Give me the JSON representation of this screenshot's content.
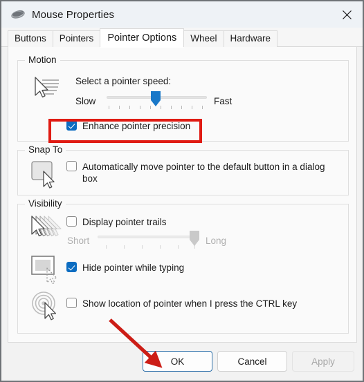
{
  "window": {
    "title": "Mouse Properties",
    "icon": "mouse-icon",
    "close_label": "✕"
  },
  "tabs": [
    {
      "label": "Buttons",
      "active": false
    },
    {
      "label": "Pointers",
      "active": false
    },
    {
      "label": "Pointer Options",
      "active": true
    },
    {
      "label": "Wheel",
      "active": false
    },
    {
      "label": "Hardware",
      "active": false
    }
  ],
  "motion": {
    "group_title": "Motion",
    "icon": "pointer-motion-icon",
    "speed_prompt": "Select a pointer speed:",
    "slow_label": "Slow",
    "fast_label": "Fast",
    "slider_value_percent": 50,
    "tick_count": 10,
    "enhance_precision": {
      "label": "Enhance pointer precision",
      "checked": true,
      "highlighted": true
    }
  },
  "snap_to": {
    "group_title": "Snap To",
    "icon": "snap-to-button-icon",
    "auto_move": {
      "label": "Automatically move pointer to the default button in a dialog box",
      "checked": false
    }
  },
  "visibility": {
    "group_title": "Visibility",
    "trails": {
      "icon": "pointer-trails-icon",
      "label": "Display pointer trails",
      "checked": false,
      "disabled_slider": true,
      "short_label": "Short",
      "long_label": "Long",
      "slider_value_percent": 96,
      "tick_count": 6
    },
    "hide_typing": {
      "icon": "hide-pointer-typing-icon",
      "label": "Hide pointer while typing",
      "checked": true
    },
    "show_location": {
      "icon": "show-pointer-location-icon",
      "label": "Show location of pointer when I press the CTRL key",
      "checked": false
    }
  },
  "footer": {
    "ok": "OK",
    "cancel": "Cancel",
    "apply": "Apply",
    "apply_disabled": true,
    "ok_focused": true
  },
  "annotations": {
    "highlight_color": "#e01b13",
    "arrow_color": "#cc1d16",
    "arrow_target": "OK"
  },
  "colors": {
    "accent": "#0b6cc1",
    "titlebar": "#eef2f6",
    "pane": "#fafafa",
    "footer": "#f2f2f2",
    "border": "#6e7276"
  }
}
